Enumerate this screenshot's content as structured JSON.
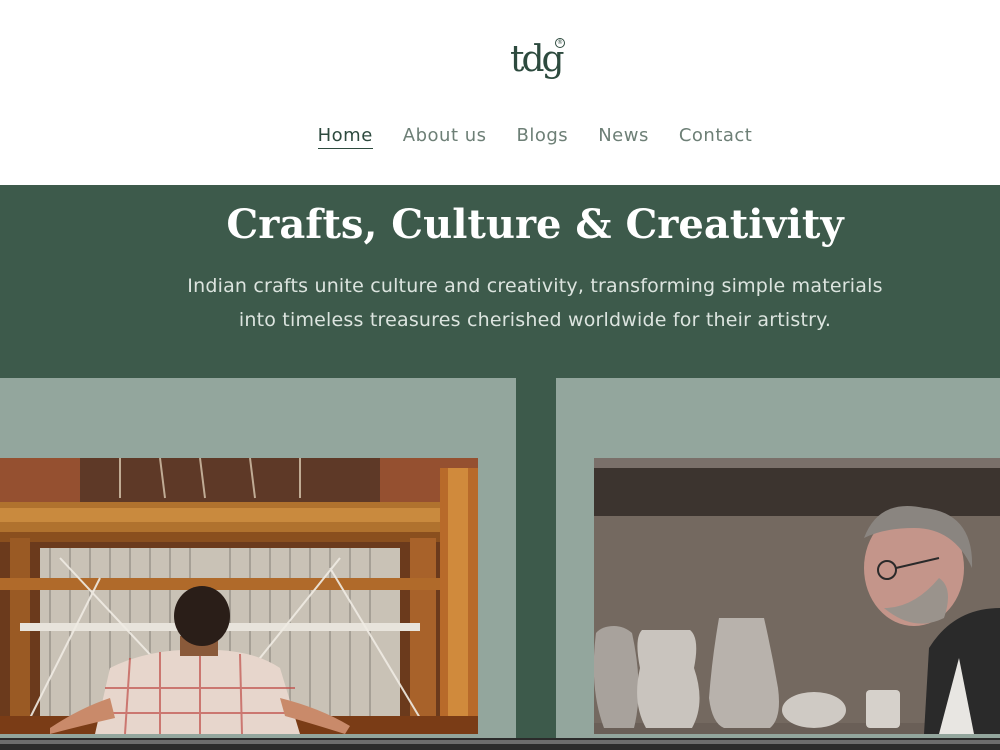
{
  "header": {
    "logo_text": "tdg",
    "logo_mark": "®"
  },
  "nav": {
    "items": [
      {
        "label": "Home",
        "active": true
      },
      {
        "label": "About us",
        "active": false
      },
      {
        "label": "Blogs",
        "active": false
      },
      {
        "label": "News",
        "active": false
      },
      {
        "label": "Contact",
        "active": false
      }
    ]
  },
  "hero": {
    "title": "Crafts, Culture & Creativity",
    "subtitle_line1": "Indian crafts unite culture and creativity, transforming simple materials",
    "subtitle_line2": "into timeless treasures cherished worldwide for their artistry."
  },
  "images": {
    "left": {
      "subject": "weaver-at-wooden-loom"
    },
    "right": {
      "subject": "potter-with-ceramic-vases"
    }
  },
  "colors": {
    "brand_green": "#3d5a4b",
    "card_sage": "#93a69d",
    "nav_text": "#6d7f76",
    "nav_active": "#2d4a3e"
  }
}
